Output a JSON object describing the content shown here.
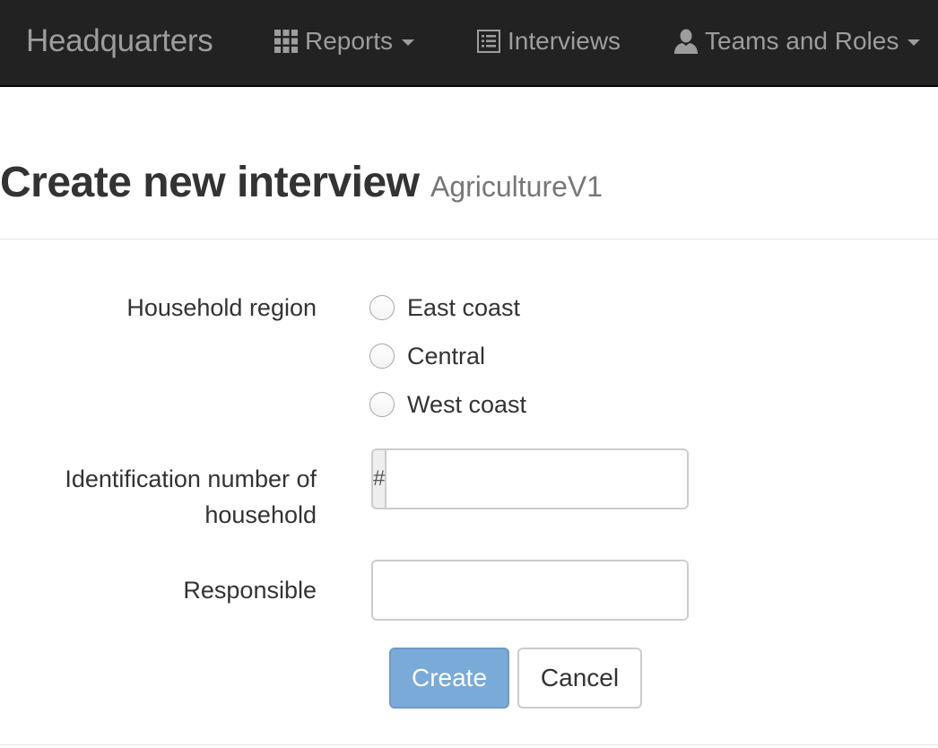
{
  "navbar": {
    "brand": "Headquarters",
    "items": [
      {
        "label": "Reports",
        "icon": "grid-icon",
        "has_dropdown": true
      },
      {
        "label": "Interviews",
        "icon": "list-icon",
        "has_dropdown": false
      },
      {
        "label": "Teams and Roles",
        "icon": "user-icon",
        "has_dropdown": true
      }
    ]
  },
  "header": {
    "title": "Create new interview",
    "subtitle": "AgricultureV1"
  },
  "form": {
    "region": {
      "label": "Household region",
      "options": [
        "East coast",
        "Central",
        "West coast"
      ],
      "selected": null
    },
    "household_id": {
      "label": "Identification number of household",
      "addon": "#",
      "value": ""
    },
    "responsible": {
      "label": "Responsible",
      "value": "",
      "clear_icon": "close-icon"
    },
    "buttons": {
      "create": "Create",
      "cancel": "Cancel"
    }
  },
  "colors": {
    "navbar_bg": "#222222",
    "navbar_text": "#9d9d9d",
    "primary_disabled": "#7aaad8"
  }
}
